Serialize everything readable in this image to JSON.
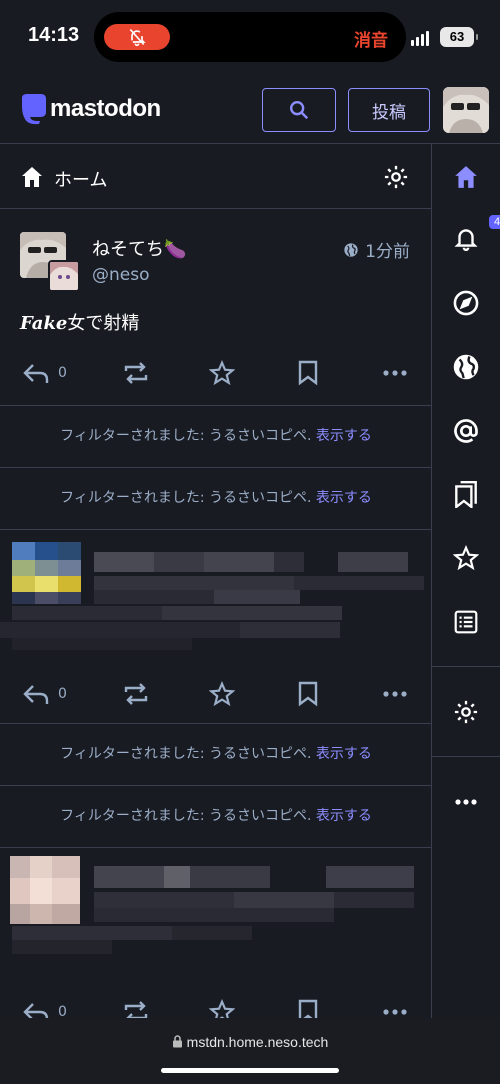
{
  "statusbar": {
    "time": "14:13",
    "mute_label": "消音",
    "battery": "63"
  },
  "header": {
    "logo_text": "mastodon",
    "post_label": "投稿"
  },
  "column": {
    "title": "ホーム"
  },
  "status": {
    "display_name": "ねそてち🍆",
    "handle": "@neso",
    "time": "1分前",
    "body_emph": "Fake",
    "body_rest": "女で射精",
    "reply_count": "0"
  },
  "filtered": {
    "text": "フィルターされました: うるさいコピペ.",
    "show_label": "表示する"
  },
  "post2": {
    "reply_count": "0"
  },
  "post3": {
    "reply_count": "0"
  },
  "nav": {
    "notifications_badge": "4"
  },
  "browser": {
    "url": "mstdn.home.neso.tech"
  },
  "colors": {
    "background": "#191b22",
    "accent": "#8c8dff",
    "brand": "#6364ff",
    "muted": "#9baec8",
    "alert": "#e8442e"
  }
}
